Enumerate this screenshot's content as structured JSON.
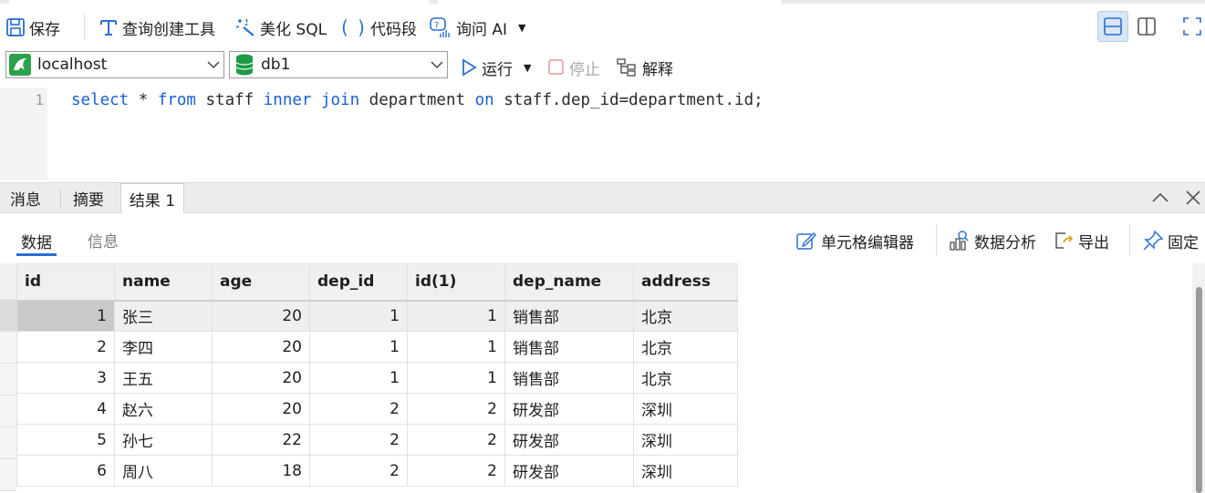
{
  "toolbar": {
    "save_label": "保存",
    "query_builder_label": "查询创建工具",
    "beautify_label": "美化 SQL",
    "snippets_label": "代码段",
    "ask_ai_label": "询问 AI"
  },
  "connection": {
    "server_value": "localhost",
    "database_value": "db1",
    "run_label": "运行",
    "stop_label": "停止",
    "explain_label": "解释"
  },
  "editor": {
    "line_number": "1",
    "tokens": [
      {
        "text": "select",
        "type": "kw"
      },
      {
        "text": " * ",
        "type": "id"
      },
      {
        "text": "from",
        "type": "kw"
      },
      {
        "text": " staff ",
        "type": "id"
      },
      {
        "text": "inner",
        "type": "kw"
      },
      {
        "text": " ",
        "type": "id"
      },
      {
        "text": "join",
        "type": "kw"
      },
      {
        "text": " department ",
        "type": "id"
      },
      {
        "text": "on",
        "type": "kw"
      },
      {
        "text": " staff.dep_id=department.id;",
        "type": "id"
      }
    ]
  },
  "result_tabs": {
    "messages": "消息",
    "summary": "摘要",
    "result1": "结果 1"
  },
  "result_subtabs": {
    "data": "数据",
    "info": "信息"
  },
  "result_toolbar": {
    "cell_editor_label": "单元格编辑器",
    "data_analysis_label": "数据分析",
    "export_label": "导出",
    "pin_label": "固定"
  },
  "grid": {
    "columns": [
      "id",
      "name",
      "age",
      "dep_id",
      "id(1)",
      "dep_name",
      "address"
    ],
    "rows": [
      [
        "1",
        "张三",
        "20",
        "1",
        "1",
        "销售部",
        "北京"
      ],
      [
        "2",
        "李四",
        "20",
        "1",
        "1",
        "销售部",
        "北京"
      ],
      [
        "3",
        "王五",
        "20",
        "1",
        "1",
        "销售部",
        "北京"
      ],
      [
        "4",
        "赵六",
        "20",
        "2",
        "2",
        "研发部",
        "深圳"
      ],
      [
        "5",
        "孙七",
        "22",
        "2",
        "2",
        "研发部",
        "深圳"
      ],
      [
        "6",
        "周八",
        "18",
        "2",
        "2",
        "研发部",
        "深圳"
      ]
    ]
  },
  "colors": {
    "accent": "#2b6fd1",
    "keyword": "#1a5fd6",
    "run_green": "#2aa14a",
    "db_green": "#1f9a46"
  }
}
